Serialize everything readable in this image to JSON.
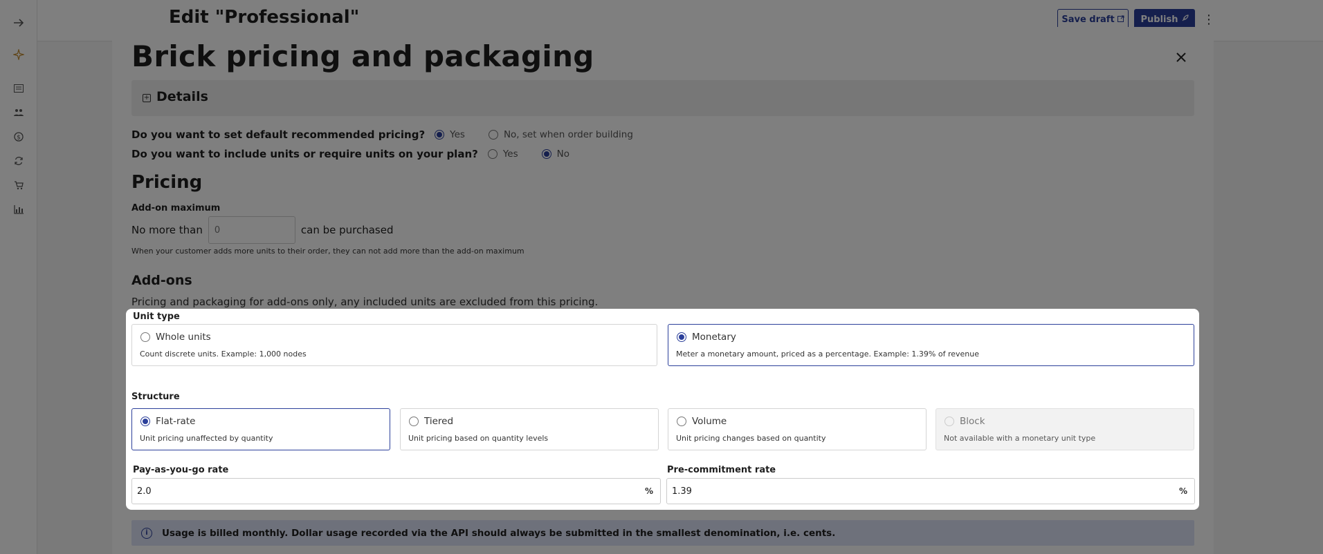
{
  "header": {
    "title": "Edit \"Professional\"",
    "save_draft": "Save draft",
    "publish": "Publish"
  },
  "sidebar": {
    "icons": [
      "arrow-right-icon",
      "sparkle-icon",
      "list-icon",
      "users-icon",
      "dollar-icon",
      "refresh-icon",
      "cart-icon",
      "bar-chart-icon"
    ]
  },
  "modal": {
    "title": "Brick pricing and packaging",
    "details_label": "Details",
    "q1": {
      "text": "Do you want to set default recommended pricing?",
      "opt_yes": "Yes",
      "opt_no": "No, set when order building",
      "selected": "Yes"
    },
    "q2": {
      "text": "Do you want to include units or require units on your plan?",
      "opt_yes": "Yes",
      "opt_no": "No",
      "selected": "No"
    },
    "pricing_heading": "Pricing",
    "addon_max_label": "Add-on maximum",
    "no_more_than": "No more than",
    "max_placeholder": "0",
    "can_be_purchased": "can be purchased",
    "max_helper": "When your customer adds more units to their order, they can not add more than the add-on maximum",
    "addons_heading": "Add-ons",
    "addons_desc": "Pricing and packaging for add-ons only, any included units are excluded from this pricing.",
    "info_banner": "Usage is billed monthly. Dollar usage recorded via the API should always be submitted in the smallest denomination, i.e. cents."
  },
  "unit_type": {
    "label": "Unit type",
    "options": [
      {
        "title": "Whole units",
        "desc": "Count discrete units. Example: 1,000 nodes",
        "selected": false
      },
      {
        "title": "Monetary",
        "desc": "Meter a monetary amount, priced as a percentage. Example: 1.39% of revenue",
        "selected": true
      }
    ]
  },
  "structure": {
    "label": "Structure",
    "options": [
      {
        "title": "Flat-rate",
        "desc": "Unit pricing unaffected by quantity",
        "selected": true
      },
      {
        "title": "Tiered",
        "desc": "Unit pricing based on quantity levels",
        "selected": false
      },
      {
        "title": "Volume",
        "desc": "Unit pricing changes based on quantity",
        "selected": false
      },
      {
        "title": "Block",
        "desc": "Not available with a monetary unit type",
        "selected": false,
        "disabled": true
      }
    ]
  },
  "rates": {
    "payg_label": "Pay-as-you-go rate",
    "payg_value": "2.0",
    "precommit_label": "Pre-commitment rate",
    "precommit_value": "1.39"
  },
  "colors": {
    "accent": "#2b3f9a",
    "banner_bg": "#dde3f6"
  }
}
